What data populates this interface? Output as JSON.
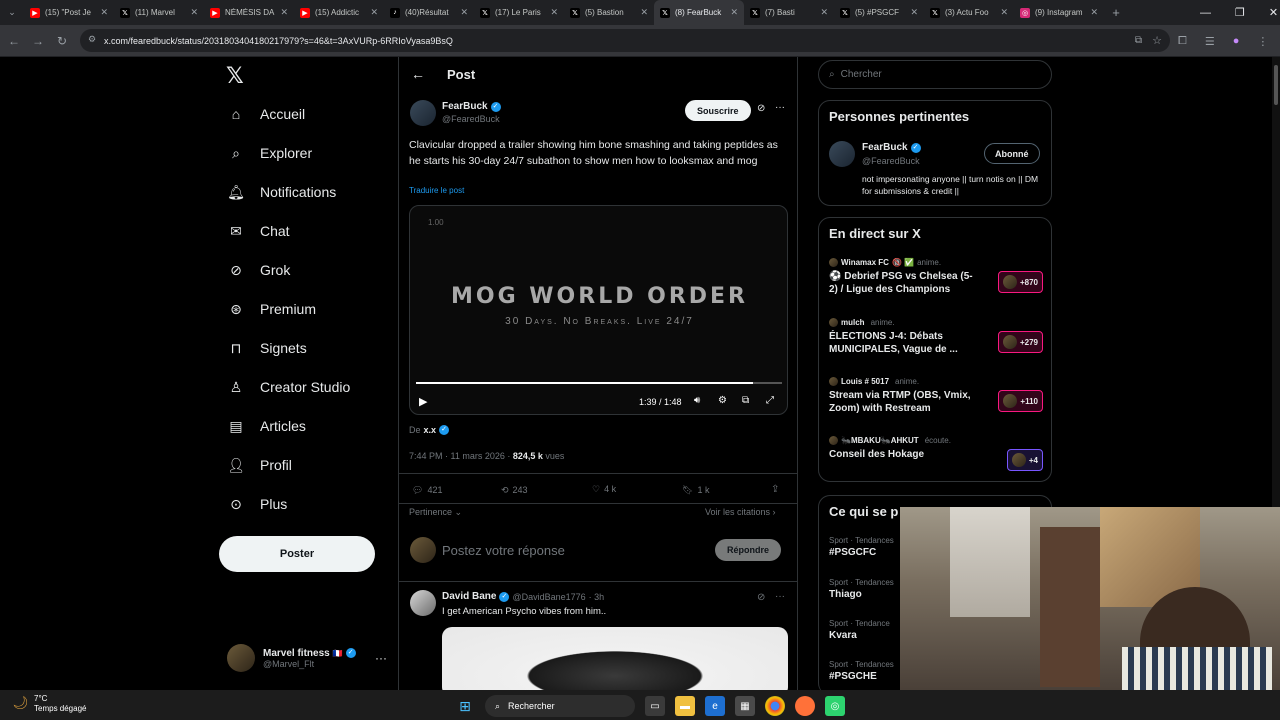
{
  "tabs": [
    {
      "label": "(15) \"Post Je",
      "icon": "youtube",
      "color": "#ff0000",
      "active": false
    },
    {
      "label": "(11) Marvel",
      "icon": "x",
      "color": "#000000",
      "active": false
    },
    {
      "label": "NÉMÉSIS DA",
      "icon": "youtube",
      "color": "#ff0000",
      "active": false
    },
    {
      "label": "(15) Addictic",
      "icon": "youtube",
      "color": "#ff0000",
      "active": false
    },
    {
      "label": "(40)Résultat",
      "icon": "tiktok",
      "color": "#000000",
      "active": false
    },
    {
      "label": "(17) Le Paris",
      "icon": "x",
      "color": "#000000",
      "active": false
    },
    {
      "label": "(5) Bastion",
      "icon": "x",
      "color": "#000000",
      "active": false
    },
    {
      "label": "(8) FearBuck",
      "icon": "x",
      "color": "#000000",
      "active": true
    },
    {
      "label": "(7) Basti",
      "icon": "x",
      "color": "#000000",
      "active": false
    },
    {
      "label": "(5) #PSGCF",
      "icon": "x",
      "color": "#000000",
      "active": false
    },
    {
      "label": "(3) Actu Foo",
      "icon": "x",
      "color": "#000000",
      "active": false
    },
    {
      "label": "(9) Instagram",
      "icon": "instagram",
      "color": "#d62976",
      "active": false
    }
  ],
  "address": {
    "url": "x.com/fearedbuck/status/2031803404180217979?s=46&t=3AxVURp-6RRIoVyasa9BsQ"
  },
  "sidebar": {
    "items": [
      {
        "label": "Accueil",
        "icon": "home-icon"
      },
      {
        "label": "Explorer",
        "icon": "search-icon"
      },
      {
        "label": "Notifications",
        "icon": "bell-icon"
      },
      {
        "label": "Chat",
        "icon": "mail-icon"
      },
      {
        "label": "Grok",
        "icon": "grok-icon"
      },
      {
        "label": "Premium",
        "icon": "premium-icon"
      },
      {
        "label": "Signets",
        "icon": "bookmark-icon"
      },
      {
        "label": "Creator Studio",
        "icon": "creator-icon"
      },
      {
        "label": "Articles",
        "icon": "articles-icon"
      },
      {
        "label": "Profil",
        "icon": "profile-icon"
      },
      {
        "label": "Plus",
        "icon": "more-icon"
      }
    ],
    "post_label": "Poster",
    "account_name": "Marvel fitness",
    "account_handle": "@Marvel_Flt",
    "account_flag": "🇫🇷"
  },
  "post": {
    "header_title": "Post",
    "author_name": "FearBuck",
    "author_handle": "@FearedBuck",
    "subscribe_label": "Souscrire",
    "text": "Clavicular dropped a trailer showing him bone smashing and taking peptides as he starts his 30-day 24/7 subathon to show men how to looksmax and mog",
    "translate": "Traduire le post",
    "video_speed": "1.00",
    "video_title": "MOG WORLD ORDER",
    "video_subtitle": "30 Days. No Breaks. Live 24/7",
    "video_time": "1:39 / 1:48",
    "video_progress": 0.92,
    "from_label": "De",
    "from_user": "x.x",
    "timestamp": "7:44 PM · 11 mars 2026 · ",
    "views_count": "824,5 k",
    "views_label": " vues",
    "replies": "421",
    "reposts": "243",
    "likes": "4 k",
    "bookmarks": "1 k",
    "sort_label": "Pertinence",
    "quotes_label": "Voir les citations",
    "reply_placeholder": "Postez votre réponse",
    "reply_button": "Répondre"
  },
  "reply": {
    "author_name": "David Bane",
    "author_handle": "@DavidBane1776",
    "age": "· 3h",
    "text": "I get American Psycho vibes from him.."
  },
  "right": {
    "search_placeholder": "Chercher",
    "relevant_title": "Personnes pertinentes",
    "relevant_name": "FearBuck",
    "relevant_handle": "@FearedBuck",
    "relevant_follow": "Abonné",
    "relevant_bio": "not impersonating anyone || turn notis on || DM for submissions & credit ||",
    "live_title": "En direct sur X",
    "live": [
      {
        "host": "Winamax FC",
        "extra": "🔞 ✅",
        "action": "anime.",
        "title": "⚽ Debrief PSG vs Chelsea (5-2) / Ligue des Champions",
        "count": "+870",
        "color": "#f91880"
      },
      {
        "host": "mulch",
        "extra": "",
        "action": "anime.",
        "title": "ÉLECTIONS J-4: Débats MUNICIPALES, Vague de ...",
        "count": "+279",
        "color": "#f91880"
      },
      {
        "host": "Louis # 5017",
        "extra": "",
        "action": "anime.",
        "title": "Stream via RTMP (OBS, Vmix, Zoom) with Restream",
        "count": "+110",
        "color": "#f91880"
      },
      {
        "host": "🐜MBAKU🐜AHKUT",
        "extra": "",
        "action": "écoute.",
        "title": "Conseil des Hokage",
        "count": "+4",
        "color": "#7856ff"
      }
    ],
    "trends_title": "Ce qui se p",
    "trends": [
      {
        "meta": "Sport · Tendances",
        "name": "#PSGCFC"
      },
      {
        "meta": "Sport · Tendances",
        "name": "Thiago"
      },
      {
        "meta": "Sport · Tendance",
        "name": "Kvara"
      },
      {
        "meta": "Sport · Tendances",
        "name": "#PSGCHE"
      }
    ]
  },
  "taskbar": {
    "weather_temp": "7°C",
    "weather_desc": "Temps dégagé",
    "search_label": "Rechercher"
  }
}
